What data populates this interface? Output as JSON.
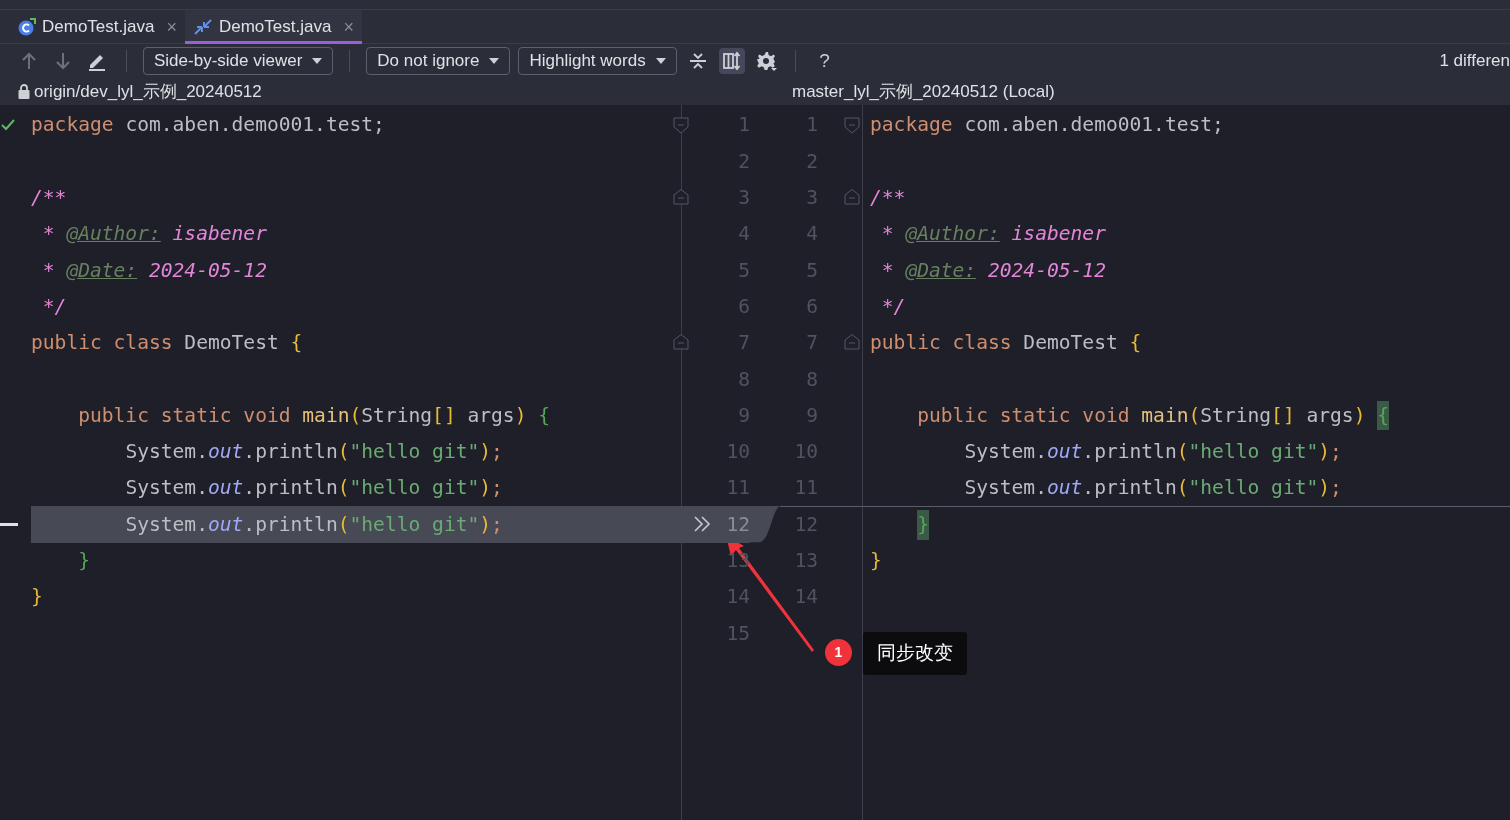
{
  "tabs": [
    {
      "label": "DemoTest.java",
      "selected": false,
      "close": "×"
    },
    {
      "label": "DemoTest.java",
      "selected": true,
      "close": "×"
    }
  ],
  "toolbar": {
    "dropdowns": [
      {
        "label": "Side-by-side viewer"
      },
      {
        "label": "Do not ignore"
      },
      {
        "label": "Highlight words"
      }
    ],
    "toggles": [
      {
        "kind": "collapse",
        "on": false
      },
      {
        "kind": "sync",
        "on": true
      }
    ],
    "help": "?",
    "differences": "1 differen"
  },
  "left": {
    "title": "origin/dev_lyl_示例_20240512",
    "locked": true,
    "inspection_ok": true,
    "lines": [
      {
        "no": "1",
        "fold_start": true,
        "changed": false,
        "tokens": [
          {
            "kind": "keyword",
            "text": "package"
          },
          {
            "kind": "plain",
            "text": " com.aben.demo001.test;"
          }
        ]
      },
      {
        "no": "2",
        "changed": false
      },
      {
        "no": "3",
        "fold_end": true,
        "changed": false,
        "tokens": [
          {
            "kind": "doc",
            "text": "/**"
          }
        ]
      },
      {
        "no": "4",
        "changed": false,
        "tokens": [
          {
            "kind": "doc",
            "text": " * "
          },
          {
            "kind": "doctag",
            "text": "@Author:"
          },
          {
            "kind": "docval",
            "text": " isabener"
          }
        ]
      },
      {
        "no": "5",
        "changed": false,
        "tokens": [
          {
            "kind": "doc",
            "text": " * "
          },
          {
            "kind": "doctag",
            "text": "@Date:"
          },
          {
            "kind": "docval",
            "text": " 2024-05-12"
          }
        ]
      },
      {
        "no": "6",
        "changed": false,
        "tokens": [
          {
            "kind": "doc",
            "text": " */"
          }
        ]
      },
      {
        "no": "7",
        "fold_end": true,
        "changed": false,
        "tokens": [
          {
            "kind": "keyword",
            "text": "public class"
          },
          {
            "kind": "plain",
            "text": " DemoTest "
          },
          {
            "kind": "paren",
            "text": "{"
          }
        ]
      },
      {
        "no": "8",
        "changed": false
      },
      {
        "no": "9",
        "changed": false,
        "tokens": [
          {
            "kind": "keyword",
            "text": "    public static void"
          },
          {
            "kind": "method",
            "text": " main"
          },
          {
            "kind": "paren",
            "text": "("
          },
          {
            "kind": "plain",
            "text": "String"
          },
          {
            "kind": "paren",
            "text": "[]"
          },
          {
            "kind": "plain",
            "text": " args"
          },
          {
            "kind": "paren",
            "text": ")"
          },
          {
            "kind": "brace",
            "text": " {"
          }
        ]
      },
      {
        "no": "10",
        "changed": false,
        "tokens": [
          {
            "kind": "plain",
            "text": "        System."
          },
          {
            "kind": "field",
            "text": "out"
          },
          {
            "kind": "plain",
            "text": ".println"
          },
          {
            "kind": "paren",
            "text": "("
          },
          {
            "kind": "string",
            "text": "\"hello git\""
          },
          {
            "kind": "paren",
            "text": ")"
          },
          {
            "kind": "keyword",
            "text": ";"
          }
        ]
      },
      {
        "no": "11",
        "changed": false,
        "tokens": [
          {
            "kind": "plain",
            "text": "        System."
          },
          {
            "kind": "field",
            "text": "out"
          },
          {
            "kind": "plain",
            "text": ".println"
          },
          {
            "kind": "paren",
            "text": "("
          },
          {
            "kind": "string",
            "text": "\"hello git\""
          },
          {
            "kind": "paren",
            "text": ")"
          },
          {
            "kind": "keyword",
            "text": ";"
          }
        ]
      },
      {
        "no": "12",
        "changed": true,
        "tokens": [
          {
            "kind": "plain",
            "text": "        System."
          },
          {
            "kind": "field",
            "text": "out"
          },
          {
            "kind": "plain",
            "text": ".println"
          },
          {
            "kind": "paren",
            "text": "("
          },
          {
            "kind": "string",
            "text": "\"hello git\""
          },
          {
            "kind": "paren",
            "text": ")"
          },
          {
            "kind": "keyword",
            "text": ";"
          }
        ]
      },
      {
        "no": "13",
        "changed": false,
        "tokens": [
          {
            "kind": "brace",
            "text": "    }"
          }
        ]
      },
      {
        "no": "14",
        "changed": false,
        "tokens": [
          {
            "kind": "paren",
            "text": "}"
          }
        ]
      },
      {
        "no": "15",
        "changed": false
      }
    ]
  },
  "right": {
    "title": "master_lyl_示例_20240512 (Local)",
    "lines": [
      {
        "no": "1",
        "fold_start": true,
        "gap_before": false,
        "tokens": [
          {
            "kind": "keyword",
            "text": "package"
          },
          {
            "kind": "plain",
            "text": " com.aben.demo001.test;"
          }
        ]
      },
      {
        "no": "2",
        "gap_before": false
      },
      {
        "no": "3",
        "fold_end": true,
        "gap_before": false,
        "tokens": [
          {
            "kind": "doc",
            "text": "/**"
          }
        ]
      },
      {
        "no": "4",
        "gap_before": false,
        "tokens": [
          {
            "kind": "doc",
            "text": " * "
          },
          {
            "kind": "doctag",
            "text": "@Author:"
          },
          {
            "kind": "docval",
            "text": " isabener"
          }
        ]
      },
      {
        "no": "5",
        "gap_before": false,
        "tokens": [
          {
            "kind": "doc",
            "text": " * "
          },
          {
            "kind": "doctag",
            "text": "@Date:"
          },
          {
            "kind": "docval",
            "text": " 2024-05-12"
          }
        ]
      },
      {
        "no": "6",
        "gap_before": false,
        "tokens": [
          {
            "kind": "doc",
            "text": " */"
          }
        ]
      },
      {
        "no": "7",
        "fold_end": true,
        "gap_before": false,
        "tokens": [
          {
            "kind": "keyword",
            "text": "public class"
          },
          {
            "kind": "plain",
            "text": " DemoTest "
          },
          {
            "kind": "paren",
            "text": "{"
          }
        ]
      },
      {
        "no": "8",
        "gap_before": false
      },
      {
        "no": "9",
        "gap_before": false,
        "tokens": [
          {
            "kind": "keyword",
            "text": "    public static void"
          },
          {
            "kind": "method",
            "text": " main"
          },
          {
            "kind": "paren",
            "text": "("
          },
          {
            "kind": "plain",
            "text": "String"
          },
          {
            "kind": "paren",
            "text": "[]"
          },
          {
            "kind": "plain",
            "text": " args"
          },
          {
            "kind": "paren",
            "text": ")"
          },
          {
            "kind": "brace-match",
            "text": " {"
          }
        ]
      },
      {
        "no": "10",
        "gap_before": false,
        "tokens": [
          {
            "kind": "plain",
            "text": "        System."
          },
          {
            "kind": "field",
            "text": "out"
          },
          {
            "kind": "plain",
            "text": ".println"
          },
          {
            "kind": "paren",
            "text": "("
          },
          {
            "kind": "string",
            "text": "\"hello git\""
          },
          {
            "kind": "paren",
            "text": ")"
          },
          {
            "kind": "keyword",
            "text": ";"
          }
        ]
      },
      {
        "no": "11",
        "gap_before": false,
        "tokens": [
          {
            "kind": "plain",
            "text": "        System."
          },
          {
            "kind": "field",
            "text": "out"
          },
          {
            "kind": "plain",
            "text": ".println"
          },
          {
            "kind": "paren",
            "text": "("
          },
          {
            "kind": "string",
            "text": "\"hello git\""
          },
          {
            "kind": "paren",
            "text": ")"
          },
          {
            "kind": "keyword",
            "text": ";"
          }
        ]
      },
      {
        "no": "12",
        "gap_before": true,
        "tokens": [
          {
            "kind": "brace-match",
            "text": "    }"
          }
        ]
      },
      {
        "no": "13",
        "gap_before": false,
        "tokens": [
          {
            "kind": "paren",
            "text": "}"
          }
        ]
      },
      {
        "no": "14",
        "gap_before": false
      }
    ]
  },
  "annotation": {
    "badge": "1",
    "text": "同步改变"
  }
}
